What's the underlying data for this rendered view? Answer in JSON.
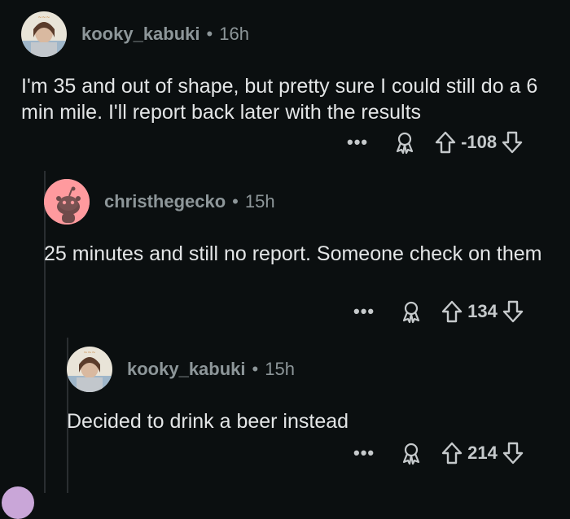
{
  "comments": [
    {
      "username": "kooky_kabuki",
      "time": "16h",
      "body": "I'm 35 and out of shape, but pretty sure I could still do a 6 min mile. I'll report back later with the results",
      "votes": "-108",
      "more": "•••"
    },
    {
      "username": "christhegecko",
      "time": "15h",
      "body": "25 minutes and still no report. Someone check on them",
      "votes": "134",
      "more": "•••"
    },
    {
      "username": "kooky_kabuki",
      "time": "15h",
      "body": "Decided to drink a beer instead",
      "votes": "214",
      "more": "•••"
    }
  ],
  "separator": "•",
  "icons": {
    "award": "award-icon",
    "upvote": "upvote-arrow-icon",
    "downvote": "downvote-arrow-icon",
    "more": "more-options-icon"
  },
  "colors": {
    "background": "#0b0f10",
    "text": "#e3e5e6",
    "meta": "#8d9699",
    "snoo_avatar_bg": "#ff9a9e"
  }
}
